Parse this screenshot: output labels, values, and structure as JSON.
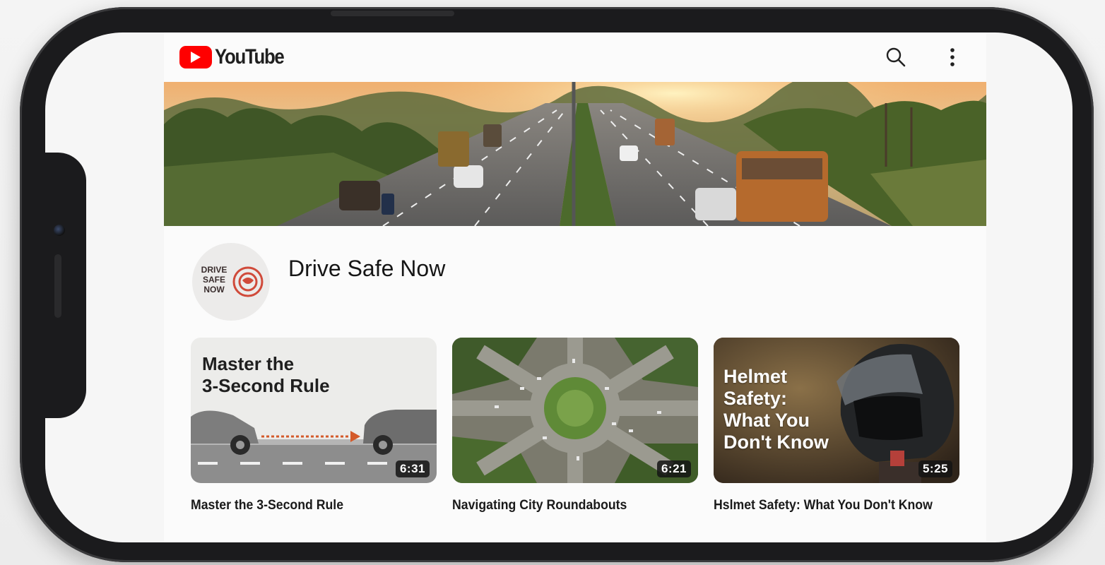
{
  "app": {
    "logo_text": "YouTube",
    "brand_color": "#ff0000"
  },
  "header": {
    "search_icon": "search-icon",
    "menu_icon": "more-vert-icon"
  },
  "channel": {
    "name": "Drive Safe Now",
    "avatar_lines": [
      "DRIVE",
      "SAFE",
      "NOW"
    ]
  },
  "videos": [
    {
      "thumb_title_lines": [
        "Master the",
        "3-Second Rule"
      ],
      "duration": "6:31",
      "title": "Master the 3-Second Rule"
    },
    {
      "duration": "6:21",
      "title": "Navigating City Roundabouts"
    },
    {
      "thumb_title_lines": [
        "Helmet",
        "Safety:",
        "What You",
        "Don't Know"
      ],
      "duration": "5:25",
      "title": "Hslmet Safety: What You Don't Know"
    }
  ]
}
